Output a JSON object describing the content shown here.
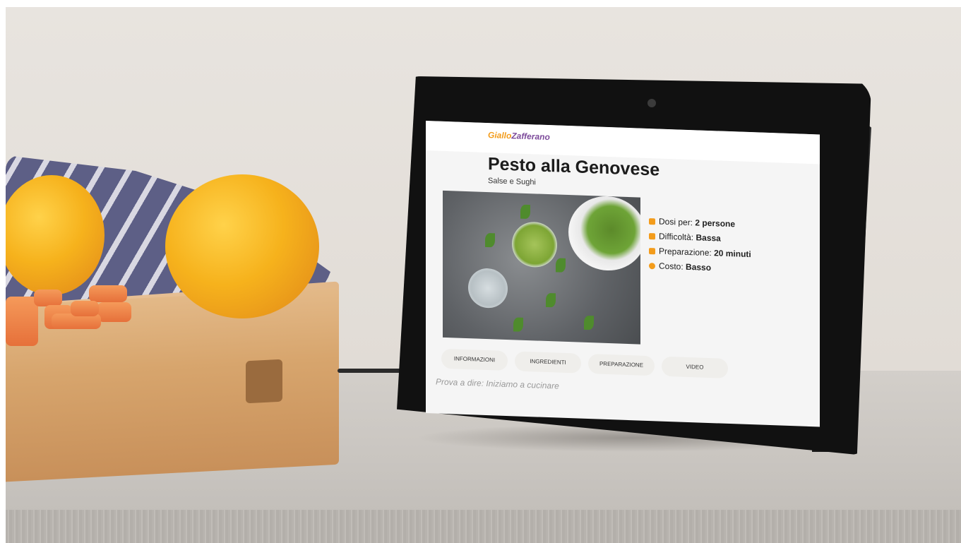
{
  "recipe_screen": {
    "logo": {
      "part_a": "Giallo",
      "part_b": "Zafferano"
    },
    "title": "Pesto alla Genovese",
    "category": "Salse e Sughi",
    "details": [
      {
        "label": "Dosi per:",
        "value": "2 persone",
        "icon": "serving-icon"
      },
      {
        "label": "Difficoltà:",
        "value": "Bassa",
        "icon": "chef-hat-icon"
      },
      {
        "label": "Preparazione:",
        "value": "20 minuti",
        "icon": "timer-icon"
      },
      {
        "label": "Costo:",
        "value": "Basso",
        "icon": "coin-icon"
      }
    ],
    "tabs": [
      "INFORMAZIONI",
      "INGREDIENTI",
      "PREPARAZIONE",
      "VIDEO"
    ],
    "hint": "Prova a dire: Iniziamo a cucinare"
  },
  "colors": {
    "accent": "#f39c1b",
    "logo_secondary": "#7d4b9b",
    "device_frame": "#111111",
    "screen_background": "#f5f5f5"
  }
}
